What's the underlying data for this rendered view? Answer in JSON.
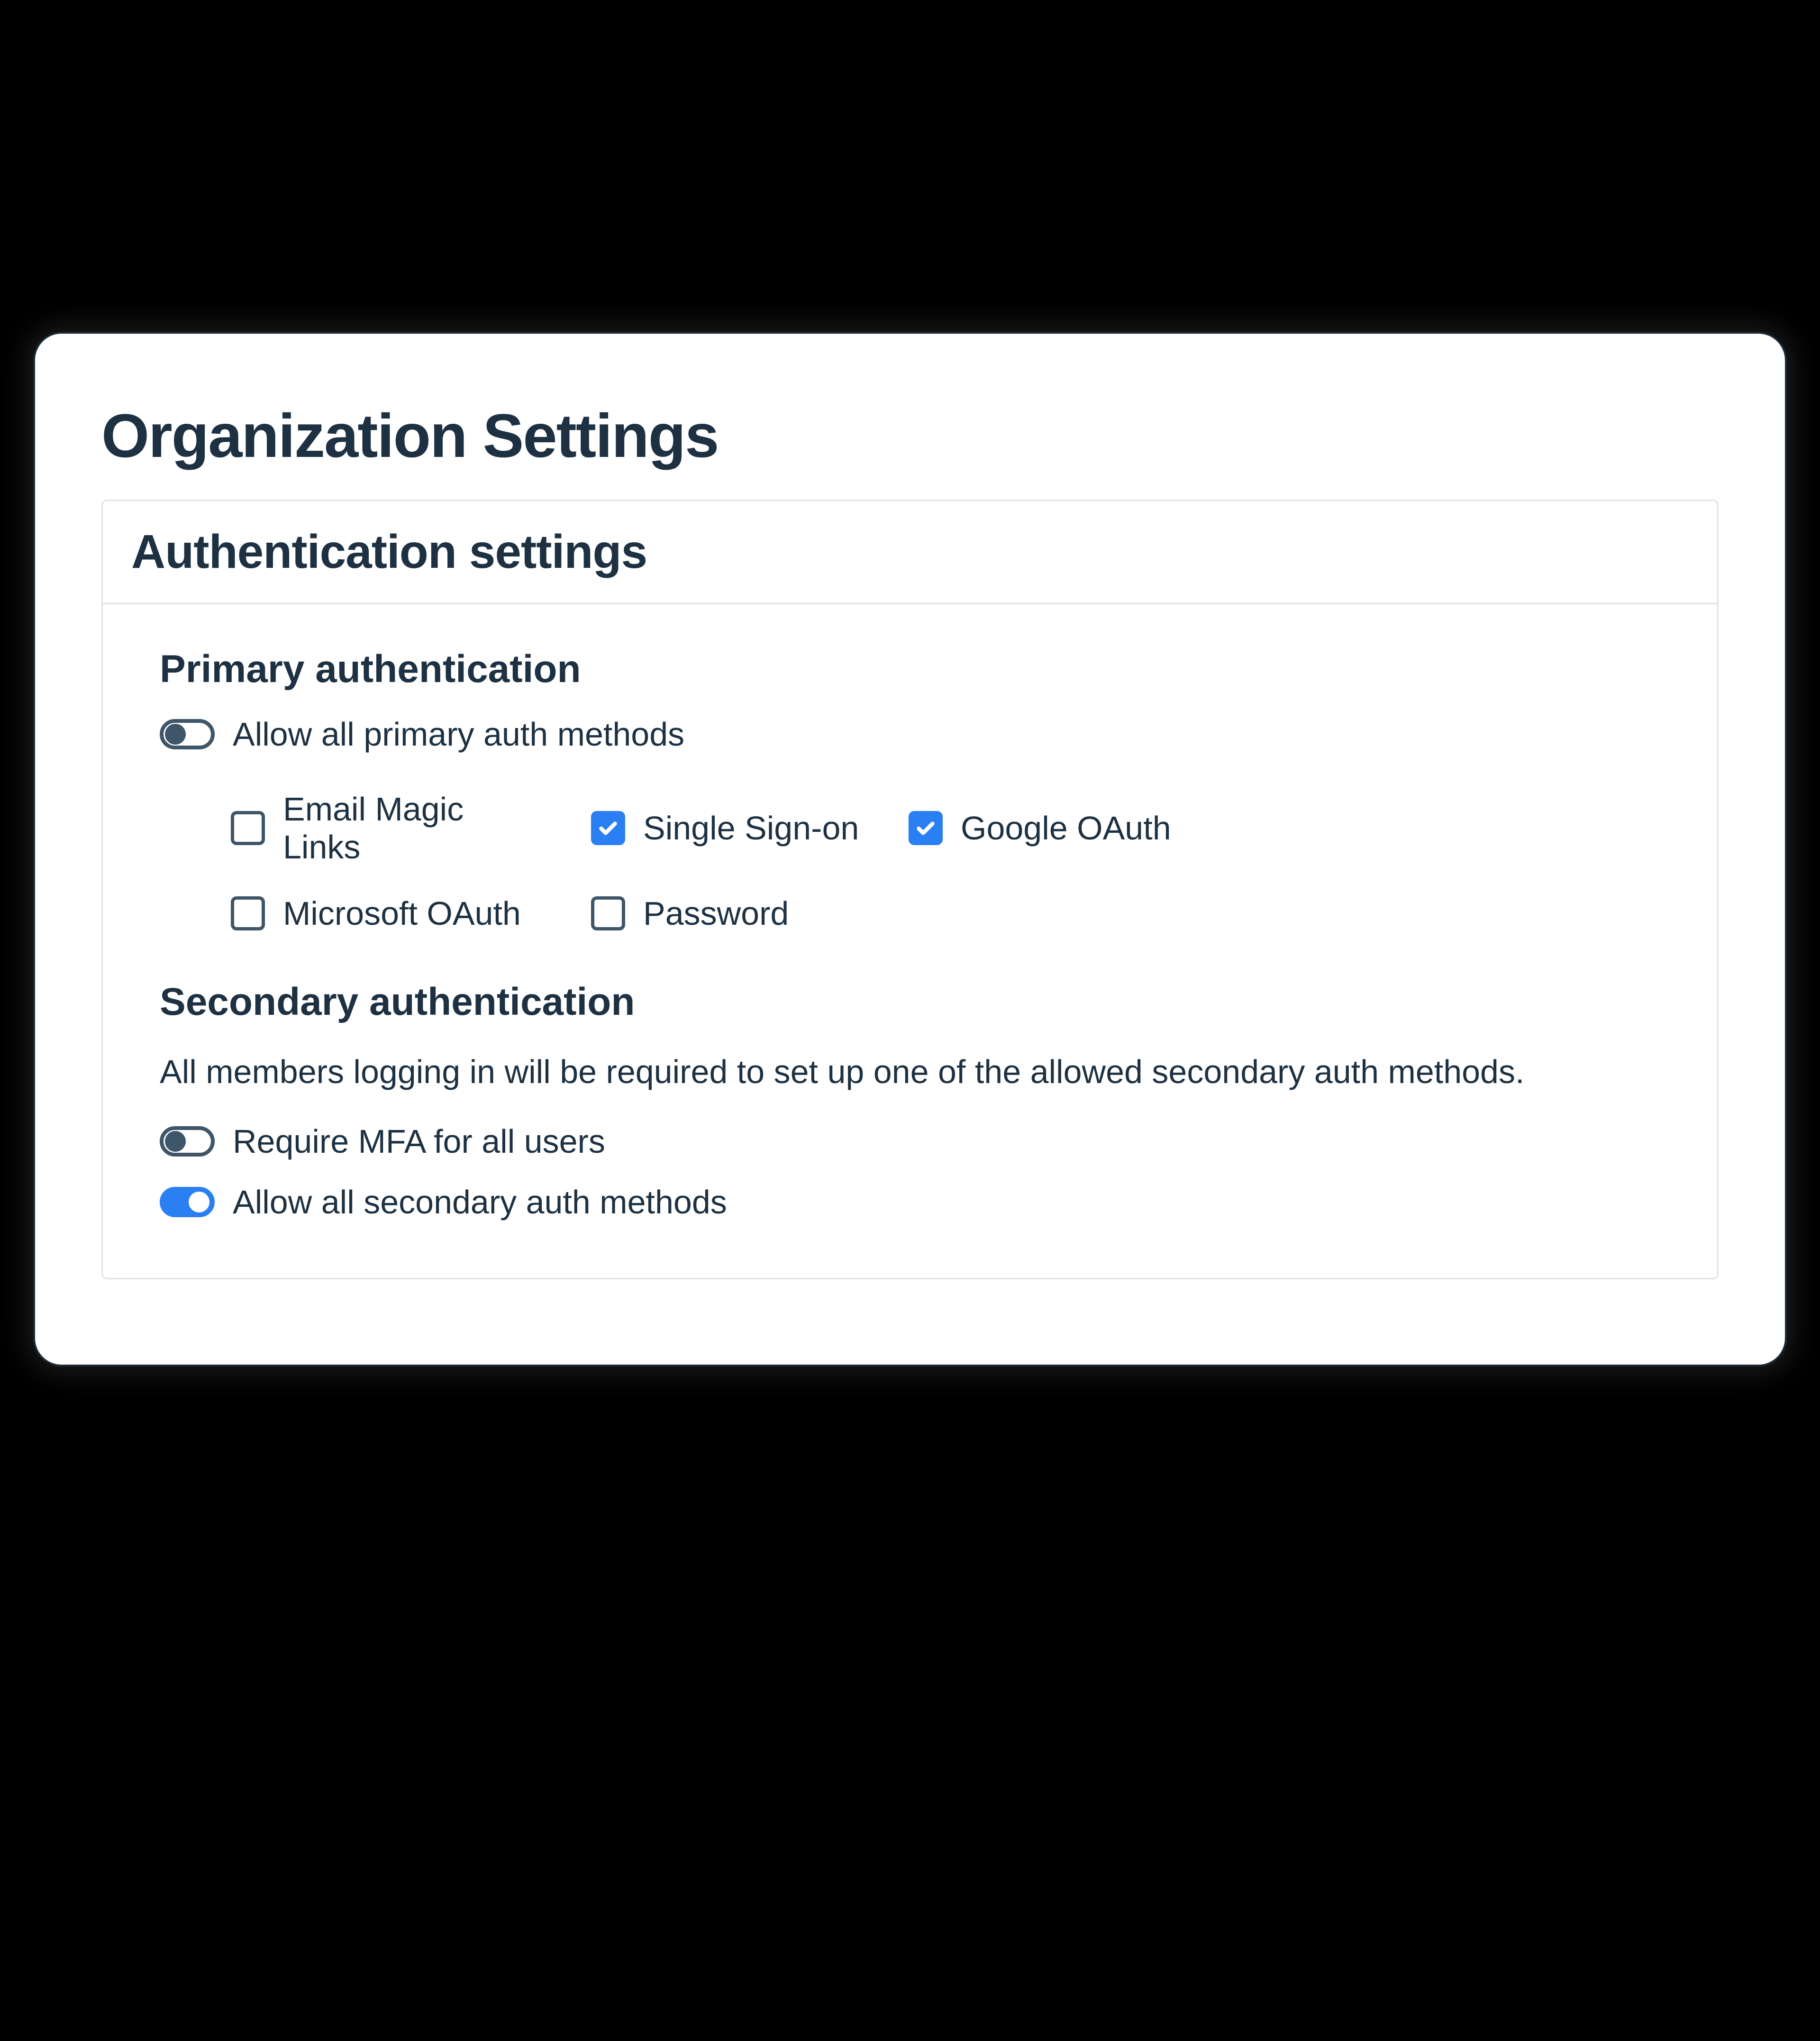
{
  "page_title": "Organization Settings",
  "card": {
    "title": "Authentication settings"
  },
  "primary": {
    "title": "Primary authentication",
    "allow_all_label": "Allow all primary auth methods",
    "allow_all_on": false,
    "methods": {
      "email_magic": {
        "label": "Email Magic Links",
        "checked": false
      },
      "sso": {
        "label": "Single Sign-on",
        "checked": true
      },
      "google": {
        "label": "Google OAuth",
        "checked": true
      },
      "microsoft": {
        "label": "Microsoft OAuth",
        "checked": false
      },
      "password": {
        "label": "Password",
        "checked": false
      }
    }
  },
  "secondary": {
    "title": "Secondary authentication",
    "description": "All members logging in will be required to set up one of the allowed secondary auth methods.",
    "require_mfa_label": "Require MFA for all users",
    "require_mfa_on": false,
    "allow_all_label": "Allow all secondary auth methods",
    "allow_all_on": true
  }
}
